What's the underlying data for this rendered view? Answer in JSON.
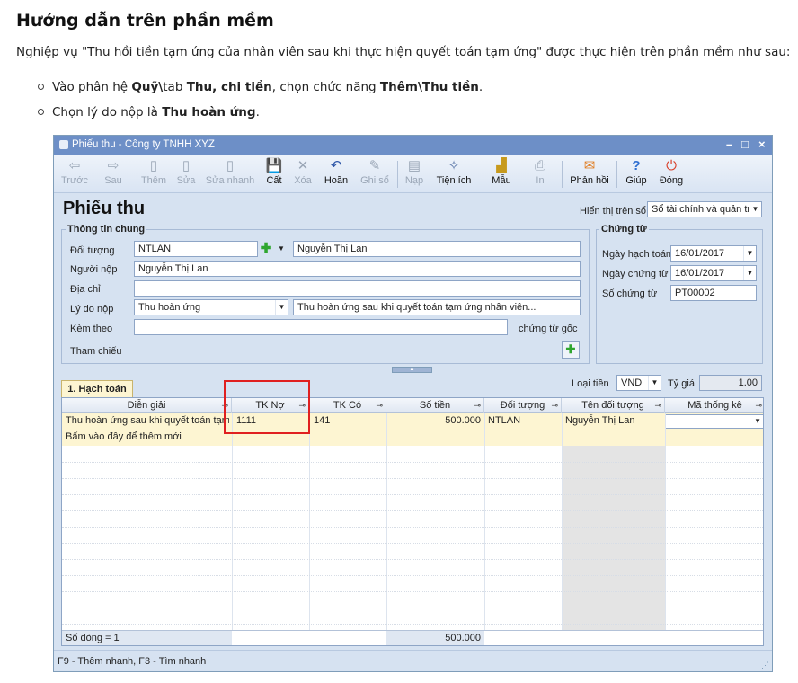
{
  "article": {
    "heading": "Hướng dẫn trên phần mềm",
    "intro": "Nghiệp vụ \"Thu hồi tiền tạm ứng của nhân viên sau khi thực hiện quyết toán tạm ứng\" được thực hiện trên phần mềm như sau:",
    "step1": {
      "t1": "Vào phân hệ ",
      "b1": "Quỹ\\",
      "t2": "tab ",
      "b2": "Thu, chi tiền",
      "t3": ", chọn chức năng ",
      "b3": "Thêm\\Thu tiền",
      "t4": "."
    },
    "step2": {
      "t1": "Chọn lý do nộp là ",
      "b1": "Thu hoàn ứng",
      "t2": "."
    }
  },
  "window": {
    "title": "Phiếu thu - Công ty TNHH XYZ",
    "controls": {
      "min": "–",
      "max": "□",
      "close": "×"
    }
  },
  "toolbar": [
    {
      "label": "Trước",
      "icon": "⇦",
      "enabled": false
    },
    {
      "label": "Sau",
      "icon": "⇨",
      "enabled": false
    },
    {
      "label": "Thêm",
      "icon": "▯",
      "enabled": false
    },
    {
      "label": "Sửa",
      "icon": "▯",
      "enabled": false
    },
    {
      "label": "Sửa nhanh",
      "icon": "▯",
      "enabled": false
    },
    {
      "label": "Cất",
      "icon": "💾",
      "enabled": true
    },
    {
      "label": "Xóa",
      "icon": "✕",
      "enabled": false
    },
    {
      "label": "Hoãn",
      "icon": "↶",
      "enabled": true
    },
    {
      "label": "Ghi sổ",
      "icon": "✎",
      "enabled": false
    },
    {
      "label": "Nạp",
      "icon": "▤",
      "enabled": false
    },
    {
      "label": "Tiện ích",
      "icon": "✧",
      "enabled": true
    },
    {
      "label": "Mẫu",
      "icon": "▟",
      "enabled": true
    },
    {
      "label": "In",
      "icon": "⎙",
      "enabled": false
    },
    {
      "label": "Phản hồi",
      "icon": "✉",
      "enabled": true
    },
    {
      "label": "Giúp",
      "icon": "?",
      "enabled": true
    },
    {
      "label": "Đóng",
      "icon": "⏻",
      "enabled": true
    }
  ],
  "form": {
    "title": "Phiếu thu",
    "hien_thi_label": "Hiển thị trên sổ",
    "hien_thi_value": "Sổ tài chính và quản trị",
    "thong_tin_chung": "Thông tin chung",
    "doi_tuong_label": "Đối tượng",
    "doi_tuong_code": "NTLAN",
    "doi_tuong_name": "Nguyễn Thị Lan",
    "nguoi_nop_label": "Người nộp",
    "nguoi_nop_value": "Nguyễn Thị Lan",
    "dia_chi_label": "Địa chỉ",
    "dia_chi_value": "",
    "ly_do_label": "Lý do nộp",
    "ly_do_value": "Thu hoàn ứng",
    "ly_do_desc": "Thu hoàn ứng sau khi quyết toán tạm ứng nhân viên...",
    "kem_theo_label": "Kèm theo",
    "kem_theo_value": "",
    "chung_tu_goc": "chứng từ gốc",
    "tham_chieu_label": "Tham chiếu",
    "chung_tu": "Chứng từ",
    "ngay_hach_toan_label": "Ngày hạch toán",
    "ngay_hach_toan_value": "16/01/2017",
    "ngay_chung_tu_label": "Ngày chứng từ",
    "ngay_chung_tu_value": "16/01/2017",
    "so_chung_tu_label": "Số chứng từ",
    "so_chung_tu_value": "PT00002",
    "loai_tien_label": "Loại tiền",
    "loai_tien_value": "VND",
    "ty_gia_label": "Tỷ giá",
    "ty_gia_value": "1.00"
  },
  "tab": {
    "label": "1. Hạch toán"
  },
  "grid": {
    "columns": [
      "Diễn giải",
      "TK Nợ",
      "TK Có",
      "Số tiền",
      "Đối tượng",
      "Tên đối tượng",
      "Mã thống kê"
    ],
    "row": {
      "dien_giai": "Thu hoàn ứng sau khi quyết toán tạm ứ",
      "tk_no": "1111",
      "tk_co": "141",
      "so_tien": "500.000",
      "doi_tuong": "NTLAN",
      "ten_doi_tuong": "Nguyễn Thị Lan",
      "ma_thong_ke": ""
    },
    "add_hint": "Bấm vào đây để thêm mới",
    "footer_count": "Số dòng = 1",
    "footer_total": "500.000"
  },
  "status": {
    "shortcuts": "F9 - Thêm nhanh, F3 - Tìm nhanh"
  },
  "colors": {
    "title_bar": "#6d8fc7",
    "form_bg": "#d6e2f1",
    "row_highlight": "#fdf5d2",
    "annotation": "#e02020"
  }
}
